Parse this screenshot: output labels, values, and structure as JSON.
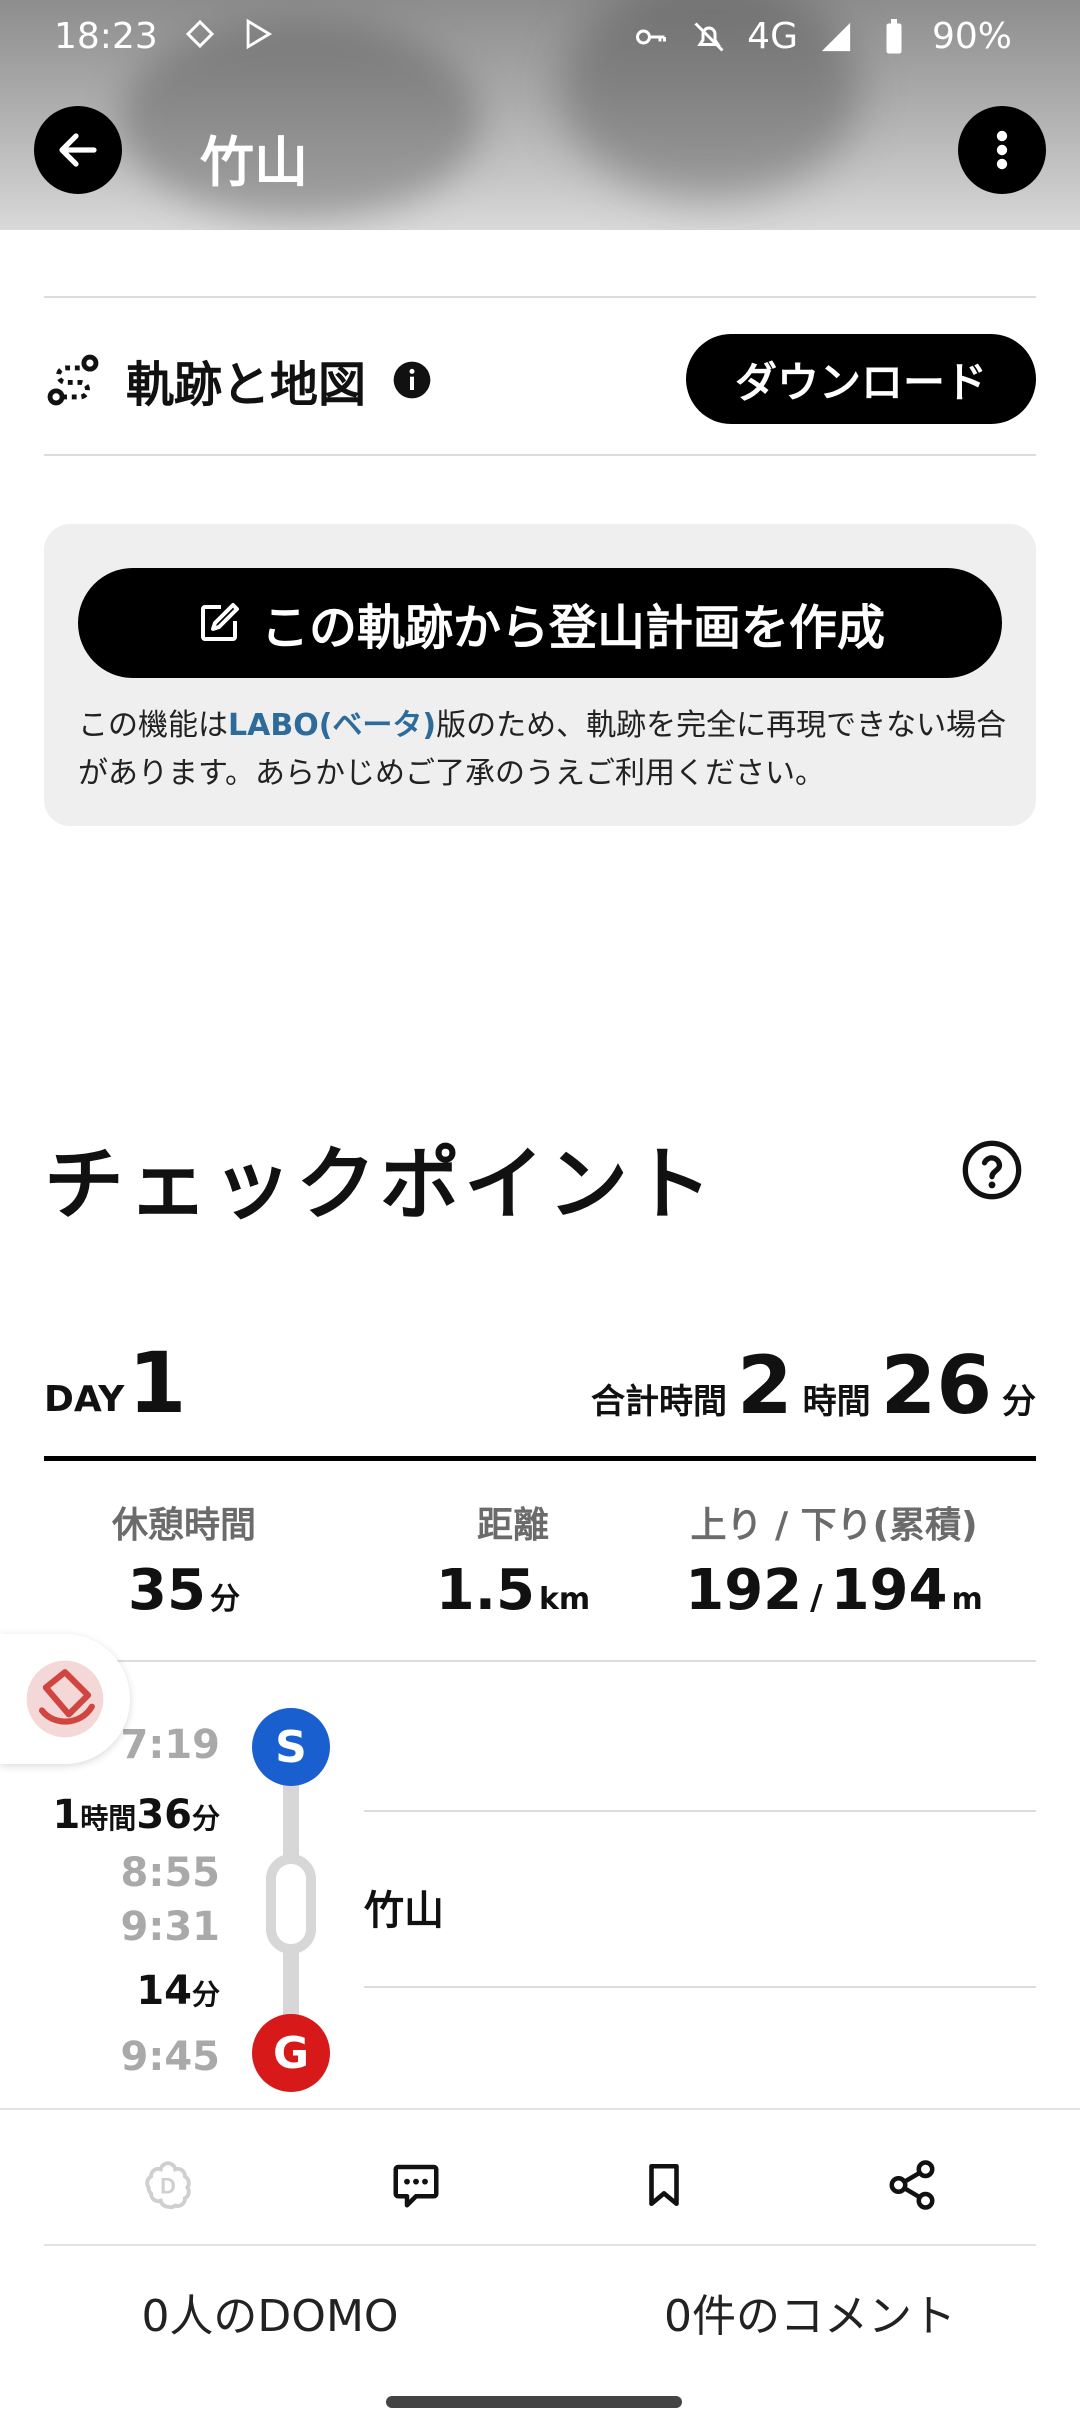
{
  "status_bar": {
    "time": "18:23",
    "network": "4G",
    "battery": "90%"
  },
  "header": {
    "title": "竹山"
  },
  "track": {
    "label": "軌跡と地図",
    "download_label": "ダウンロード"
  },
  "plan": {
    "button_label": "この軌跡から登山計画を作成",
    "note_prefix": "この機能は",
    "note_link": "LABO(ベータ)",
    "note_suffix": "版のため、軌跡を完全に再現できない場合があります。あらかじめご了承のうえご利用ください。"
  },
  "checkpoint": {
    "title": "チェックポイント",
    "day_label": "DAY",
    "day_number": "1",
    "total_label": "合計時間",
    "total_hours": "2",
    "hours_unit": "時間",
    "total_minutes": "26",
    "minutes_unit": "分",
    "stats": {
      "rest_label": "休憩時間",
      "rest_value": "35",
      "rest_unit": "分",
      "distance_label": "距離",
      "distance_value": "1.5",
      "distance_unit": "km",
      "elev_label": "上り / 下り(累積)",
      "elev_up": "192",
      "elev_sep": "/",
      "elev_down": "194",
      "elev_unit": "m"
    },
    "timeline": {
      "start_time": "7:19",
      "start_badge": "S",
      "seg1_hours": "1",
      "seg1_hours_unit": "時間",
      "seg1_minutes": "36",
      "seg1_minutes_unit": "分",
      "arrive_time": "8:55",
      "depart_time": "9:31",
      "point_name": "竹山",
      "seg2_minutes": "14",
      "seg2_minutes_unit": "分",
      "goal_time": "9:45",
      "goal_badge": "G"
    }
  },
  "footer": {
    "domo_count": "0人のDOMO",
    "comment_count": "0件のコメント"
  },
  "colors": {
    "start": "#1a5fd0",
    "goal": "#d81919",
    "labo": "#2d6b9a"
  }
}
